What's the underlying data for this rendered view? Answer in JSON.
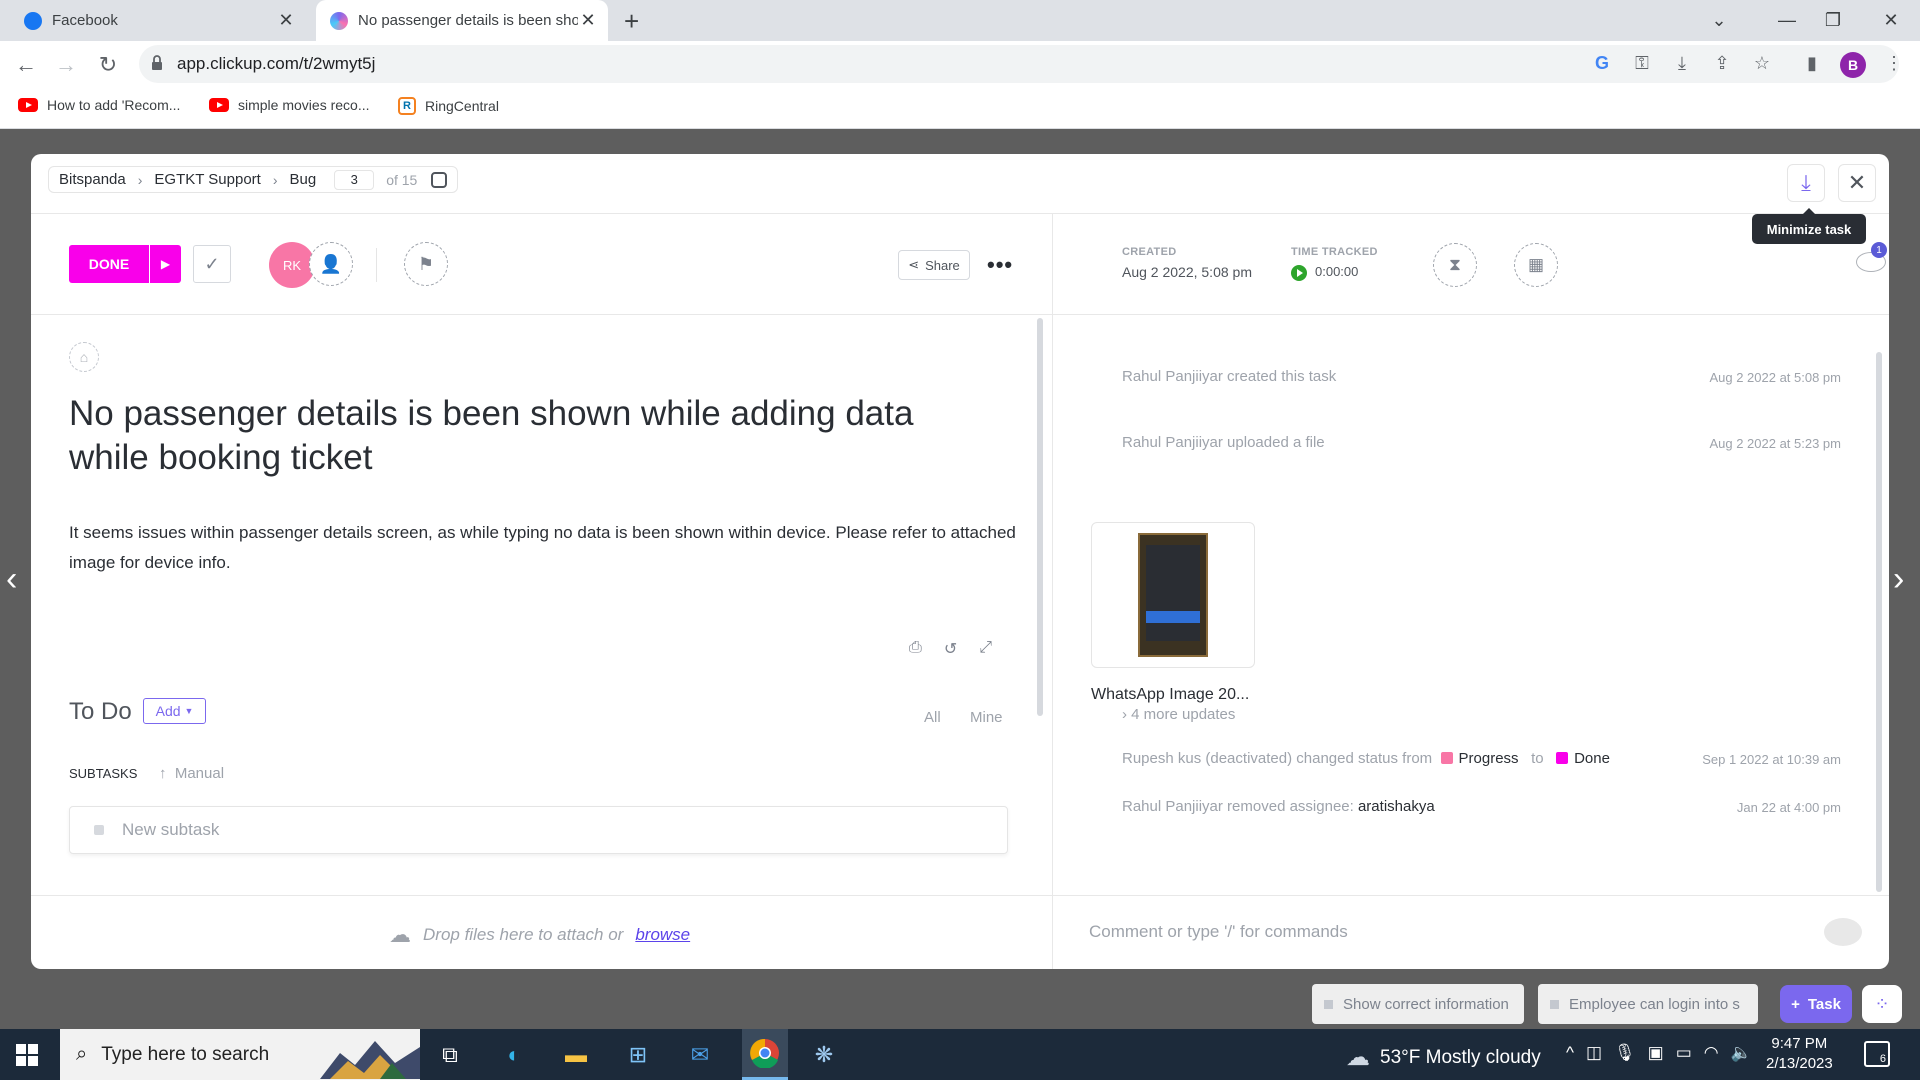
{
  "browser": {
    "tabs": [
      {
        "title": "Facebook",
        "favicon_color": "#1877f2"
      },
      {
        "title": "No passenger details is been sho",
        "favicon_color": "#7b68ee"
      }
    ],
    "url": "app.clickup.com/t/2wmyt5j",
    "profile_initial": "B",
    "bookmarks": [
      {
        "label": "How to add 'Recom...",
        "icon": "youtube-icon"
      },
      {
        "label": "simple movies reco...",
        "icon": "youtube-icon"
      },
      {
        "label": "RingCentral",
        "icon": "ringcentral-icon"
      }
    ]
  },
  "modal": {
    "breadcrumb": [
      "Bitspanda",
      "EGTKT Support",
      "Bug"
    ],
    "page_current": "3",
    "page_of": "of 15",
    "minimize_tooltip": "Minimize task",
    "status_label": "DONE",
    "status_color": "#f900ea",
    "assignee_initials": "RK",
    "share_label": "Share",
    "title": "No passenger details is been shown while adding data while booking ticket",
    "description": "It seems issues within passenger details screen, as while typing no data is been shown within device. Please refer to attached image for device info.",
    "checklist_title": "To Do",
    "add_label": "Add",
    "filter_all": "All",
    "filter_mine": "Mine",
    "subtasks_label": "SUBTASKS",
    "sort_label": "Manual",
    "new_subtask_placeholder": "New subtask",
    "drop_text": "Drop files here to attach or",
    "browse_label": "browse",
    "comment_placeholder": "Comment or type '/' for commands"
  },
  "meta": {
    "created_label": "CREATED",
    "created_value": "Aug 2 2022, 5:08 pm",
    "time_label": "TIME TRACKED",
    "time_value": "0:00:00",
    "watchers_count": "1"
  },
  "activity": {
    "created": {
      "text": "Rahul Panjiiyar created this task",
      "date": "Aug 2 2022 at 5:08 pm"
    },
    "uploaded": {
      "text": "Rahul Panjiiyar  uploaded a file",
      "date": "Aug 2 2022 at 5:23 pm"
    },
    "attachment_name": "WhatsApp Image 20...",
    "more_updates": "4 more updates",
    "status_change": {
      "prefix": "Rupesh kus (deactivated) changed status from",
      "from": "Progress",
      "from_color": "#f876a6",
      "to_word": "to",
      "to": "Done",
      "to_color": "#f900ea",
      "date": "Sep 1 2022 at 10:39 am"
    },
    "removed": {
      "prefix": "Rahul Panjiiyar removed assignee:",
      "name": "aratishakya",
      "date": "Jan 22 at 4:00 pm"
    }
  },
  "bottom_bar": {
    "items": [
      "Show correct information",
      "Employee can login into s"
    ],
    "task_button": "Task"
  },
  "taskbar": {
    "search_placeholder": "Type here to search",
    "weather": "53°F  Mostly cloudy",
    "time": "9:47 PM",
    "date": "2/13/2023",
    "notifications": "6"
  }
}
